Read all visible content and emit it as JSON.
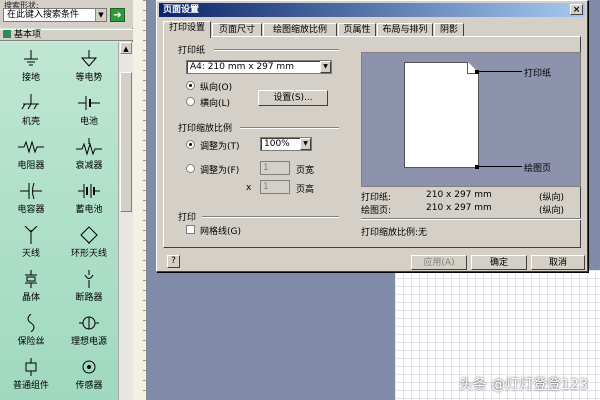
{
  "left_panel": {
    "search_label": "搜索形状:",
    "search_value": "在此键入搜索条件",
    "go_icon": "arrow-right-icon",
    "stencil_title": "基本项",
    "shapes": [
      {
        "label": "接地",
        "icon": "ground-symbol-icon"
      },
      {
        "label": "等电势",
        "icon": "equipotential-icon"
      },
      {
        "label": "机壳",
        "icon": "chassis-icon"
      },
      {
        "label": "电池",
        "icon": "battery-icon"
      },
      {
        "label": "电阻器",
        "icon": "resistor-icon"
      },
      {
        "label": "衰减器",
        "icon": "attenuator-icon"
      },
      {
        "label": "电容器",
        "icon": "capacitor-icon"
      },
      {
        "label": "蓄电池",
        "icon": "storage-battery-icon"
      },
      {
        "label": "天线",
        "icon": "antenna-icon"
      },
      {
        "label": "环形天线",
        "icon": "loop-antenna-icon"
      },
      {
        "label": "晶体",
        "icon": "crystal-icon"
      },
      {
        "label": "断路器",
        "icon": "breaker-icon"
      },
      {
        "label": "保险丝",
        "icon": "fuse-icon"
      },
      {
        "label": "理想电源",
        "icon": "ideal-source-icon"
      },
      {
        "label": "普通组件",
        "icon": "generic-component-icon"
      },
      {
        "label": "传感器",
        "icon": "sensor-icon"
      }
    ]
  },
  "dialog": {
    "title": "页面设置",
    "close_label": "×",
    "tabs": [
      "打印设置",
      "页面尺寸",
      "绘图缩放比例",
      "页属性",
      "布局与排列",
      "阴影"
    ],
    "active_tab": "打印设置",
    "printer_paper": {
      "group_label": "打印纸",
      "paper_size": "A4:  210 mm x 297 mm",
      "orientation_options": [
        "纵向(O)",
        "横向(L)"
      ],
      "selected_orientation": "纵向(O)",
      "setup_button": "设置(S)..."
    },
    "print_zoom": {
      "group_label": "打印缩放比例",
      "adjust_to_label": "调整为(T)",
      "adjust_to_value": "100%",
      "fit_to_label": "调整为(F)",
      "fit_width_value": "1",
      "fit_width_unit": "页宽",
      "fit_times": "x",
      "fit_height_value": "1",
      "fit_height_unit": "页高",
      "selected": "adjust_to"
    },
    "print": {
      "group_label": "打印",
      "gridlines_label": "网格线(G)",
      "gridlines_checked": false
    },
    "preview": {
      "paper_label": "打印纸",
      "drawing_label": "绘图页",
      "info_rows": [
        {
          "label": "打印纸:",
          "value": "210 x 297 mm",
          "orientation": "(纵向)"
        },
        {
          "label": "绘图页:",
          "value": "210 x 297 mm",
          "orientation": "(纵向)"
        }
      ],
      "zoom_text": "打印缩放比例:无"
    },
    "buttons": {
      "help": "?",
      "apply": "应用(A)",
      "ok": "确定",
      "cancel": "取消"
    }
  },
  "watermark": "头条 @灯灯登登123",
  "colors": {
    "title_bar_start": "#0a246a",
    "title_bar_end": "#a6caf0",
    "stencil_bg": "#bfe6d3",
    "canvas_bg": "#7f8ba8",
    "preview_bg": "#8d93ad"
  }
}
